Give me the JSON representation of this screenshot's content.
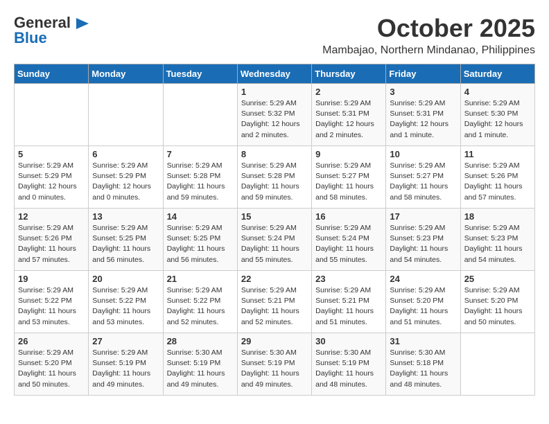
{
  "header": {
    "logo_line1": "General",
    "logo_line2": "Blue",
    "month": "October 2025",
    "location": "Mambajao, Northern Mindanao, Philippines"
  },
  "days_of_week": [
    "Sunday",
    "Monday",
    "Tuesday",
    "Wednesday",
    "Thursday",
    "Friday",
    "Saturday"
  ],
  "weeks": [
    [
      {
        "day": "",
        "info": ""
      },
      {
        "day": "",
        "info": ""
      },
      {
        "day": "",
        "info": ""
      },
      {
        "day": "1",
        "info": "Sunrise: 5:29 AM\nSunset: 5:32 PM\nDaylight: 12 hours\nand 2 minutes."
      },
      {
        "day": "2",
        "info": "Sunrise: 5:29 AM\nSunset: 5:31 PM\nDaylight: 12 hours\nand 2 minutes."
      },
      {
        "day": "3",
        "info": "Sunrise: 5:29 AM\nSunset: 5:31 PM\nDaylight: 12 hours\nand 1 minute."
      },
      {
        "day": "4",
        "info": "Sunrise: 5:29 AM\nSunset: 5:30 PM\nDaylight: 12 hours\nand 1 minute."
      }
    ],
    [
      {
        "day": "5",
        "info": "Sunrise: 5:29 AM\nSunset: 5:29 PM\nDaylight: 12 hours\nand 0 minutes."
      },
      {
        "day": "6",
        "info": "Sunrise: 5:29 AM\nSunset: 5:29 PM\nDaylight: 12 hours\nand 0 minutes."
      },
      {
        "day": "7",
        "info": "Sunrise: 5:29 AM\nSunset: 5:28 PM\nDaylight: 11 hours\nand 59 minutes."
      },
      {
        "day": "8",
        "info": "Sunrise: 5:29 AM\nSunset: 5:28 PM\nDaylight: 11 hours\nand 59 minutes."
      },
      {
        "day": "9",
        "info": "Sunrise: 5:29 AM\nSunset: 5:27 PM\nDaylight: 11 hours\nand 58 minutes."
      },
      {
        "day": "10",
        "info": "Sunrise: 5:29 AM\nSunset: 5:27 PM\nDaylight: 11 hours\nand 58 minutes."
      },
      {
        "day": "11",
        "info": "Sunrise: 5:29 AM\nSunset: 5:26 PM\nDaylight: 11 hours\nand 57 minutes."
      }
    ],
    [
      {
        "day": "12",
        "info": "Sunrise: 5:29 AM\nSunset: 5:26 PM\nDaylight: 11 hours\nand 57 minutes."
      },
      {
        "day": "13",
        "info": "Sunrise: 5:29 AM\nSunset: 5:25 PM\nDaylight: 11 hours\nand 56 minutes."
      },
      {
        "day": "14",
        "info": "Sunrise: 5:29 AM\nSunset: 5:25 PM\nDaylight: 11 hours\nand 56 minutes."
      },
      {
        "day": "15",
        "info": "Sunrise: 5:29 AM\nSunset: 5:24 PM\nDaylight: 11 hours\nand 55 minutes."
      },
      {
        "day": "16",
        "info": "Sunrise: 5:29 AM\nSunset: 5:24 PM\nDaylight: 11 hours\nand 55 minutes."
      },
      {
        "day": "17",
        "info": "Sunrise: 5:29 AM\nSunset: 5:23 PM\nDaylight: 11 hours\nand 54 minutes."
      },
      {
        "day": "18",
        "info": "Sunrise: 5:29 AM\nSunset: 5:23 PM\nDaylight: 11 hours\nand 54 minutes."
      }
    ],
    [
      {
        "day": "19",
        "info": "Sunrise: 5:29 AM\nSunset: 5:22 PM\nDaylight: 11 hours\nand 53 minutes."
      },
      {
        "day": "20",
        "info": "Sunrise: 5:29 AM\nSunset: 5:22 PM\nDaylight: 11 hours\nand 53 minutes."
      },
      {
        "day": "21",
        "info": "Sunrise: 5:29 AM\nSunset: 5:22 PM\nDaylight: 11 hours\nand 52 minutes."
      },
      {
        "day": "22",
        "info": "Sunrise: 5:29 AM\nSunset: 5:21 PM\nDaylight: 11 hours\nand 52 minutes."
      },
      {
        "day": "23",
        "info": "Sunrise: 5:29 AM\nSunset: 5:21 PM\nDaylight: 11 hours\nand 51 minutes."
      },
      {
        "day": "24",
        "info": "Sunrise: 5:29 AM\nSunset: 5:20 PM\nDaylight: 11 hours\nand 51 minutes."
      },
      {
        "day": "25",
        "info": "Sunrise: 5:29 AM\nSunset: 5:20 PM\nDaylight: 11 hours\nand 50 minutes."
      }
    ],
    [
      {
        "day": "26",
        "info": "Sunrise: 5:29 AM\nSunset: 5:20 PM\nDaylight: 11 hours\nand 50 minutes."
      },
      {
        "day": "27",
        "info": "Sunrise: 5:29 AM\nSunset: 5:19 PM\nDaylight: 11 hours\nand 49 minutes."
      },
      {
        "day": "28",
        "info": "Sunrise: 5:30 AM\nSunset: 5:19 PM\nDaylight: 11 hours\nand 49 minutes."
      },
      {
        "day": "29",
        "info": "Sunrise: 5:30 AM\nSunset: 5:19 PM\nDaylight: 11 hours\nand 49 minutes."
      },
      {
        "day": "30",
        "info": "Sunrise: 5:30 AM\nSunset: 5:19 PM\nDaylight: 11 hours\nand 48 minutes."
      },
      {
        "day": "31",
        "info": "Sunrise: 5:30 AM\nSunset: 5:18 PM\nDaylight: 11 hours\nand 48 minutes."
      },
      {
        "day": "",
        "info": ""
      }
    ]
  ]
}
